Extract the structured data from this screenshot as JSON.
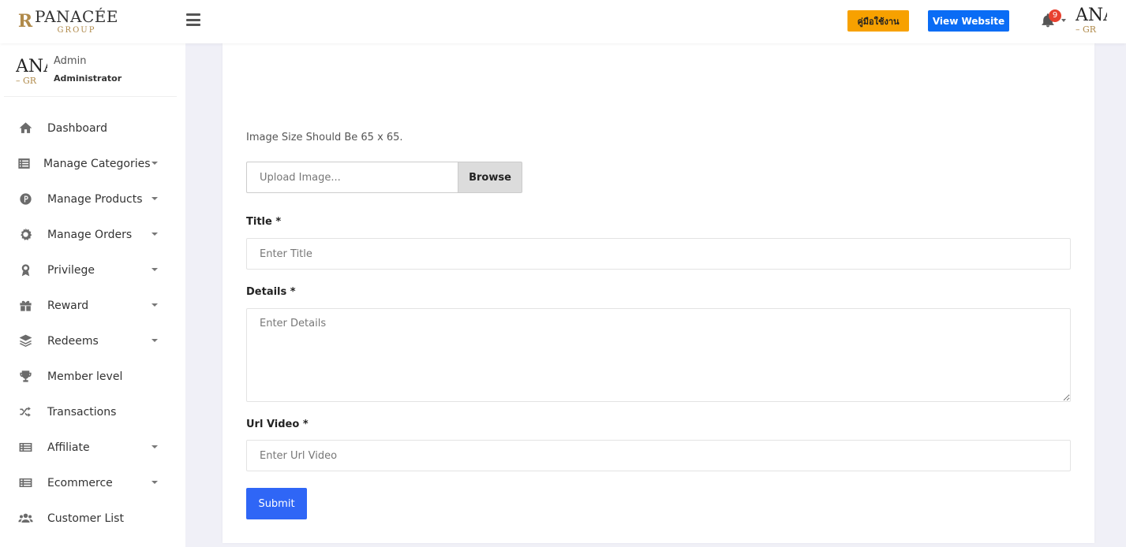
{
  "header": {
    "logo_mark": "R",
    "logo_main": "PANACÉE",
    "logo_sub": "GROUP",
    "manual_label": "คู่มือใช้งาน",
    "website_label": "View Website",
    "notification_count": "9",
    "avatar_big": "ANA",
    "avatar_small": "– GR"
  },
  "user": {
    "avatar_big": "ANA",
    "avatar_small": "– GR",
    "name": "Admin",
    "role": "Administrator"
  },
  "sidebar": {
    "items": [
      {
        "label": "Dashboard",
        "icon": "home-icon",
        "has_caret": false
      },
      {
        "label": "Manage Categories",
        "icon": "list-icon",
        "has_caret": true
      },
      {
        "label": "Manage Products",
        "icon": "product-badge-icon",
        "has_caret": true
      },
      {
        "label": "Manage Orders",
        "icon": "orders-icon",
        "has_caret": true
      },
      {
        "label": "Privilege",
        "icon": "award-icon",
        "has_caret": true
      },
      {
        "label": "Reward",
        "icon": "gift-icon",
        "has_caret": true
      },
      {
        "label": "Redeems",
        "icon": "layers-icon",
        "has_caret": true
      },
      {
        "label": "Member level",
        "icon": "trophy-icon",
        "has_caret": false
      },
      {
        "label": "Transactions",
        "icon": "shuffle-icon",
        "has_caret": false
      },
      {
        "label": "Affiliate",
        "icon": "table-icon",
        "has_caret": true
      },
      {
        "label": "Ecommerce",
        "icon": "table-icon",
        "has_caret": true
      },
      {
        "label": "Customer List",
        "icon": "users-icon",
        "has_caret": false
      }
    ]
  },
  "form": {
    "image_hint": "Image Size Should Be 65 x 65.",
    "upload_placeholder": "Upload Image...",
    "browse_label": "Browse",
    "title_label": "Title *",
    "title_placeholder": "Enter Title",
    "title_value": "",
    "details_label": "Details *",
    "details_placeholder": "Enter Details",
    "details_value": "",
    "url_label": "Url Video *",
    "url_placeholder": "Enter Url Video",
    "url_value": "",
    "submit_label": "Submit"
  },
  "colors": {
    "manual_button": "#f7a100",
    "website_button": "#0a6cf5",
    "submit_button": "#2f66f6",
    "badge": "#e8412f",
    "brand_gold": "#b08a4a"
  }
}
